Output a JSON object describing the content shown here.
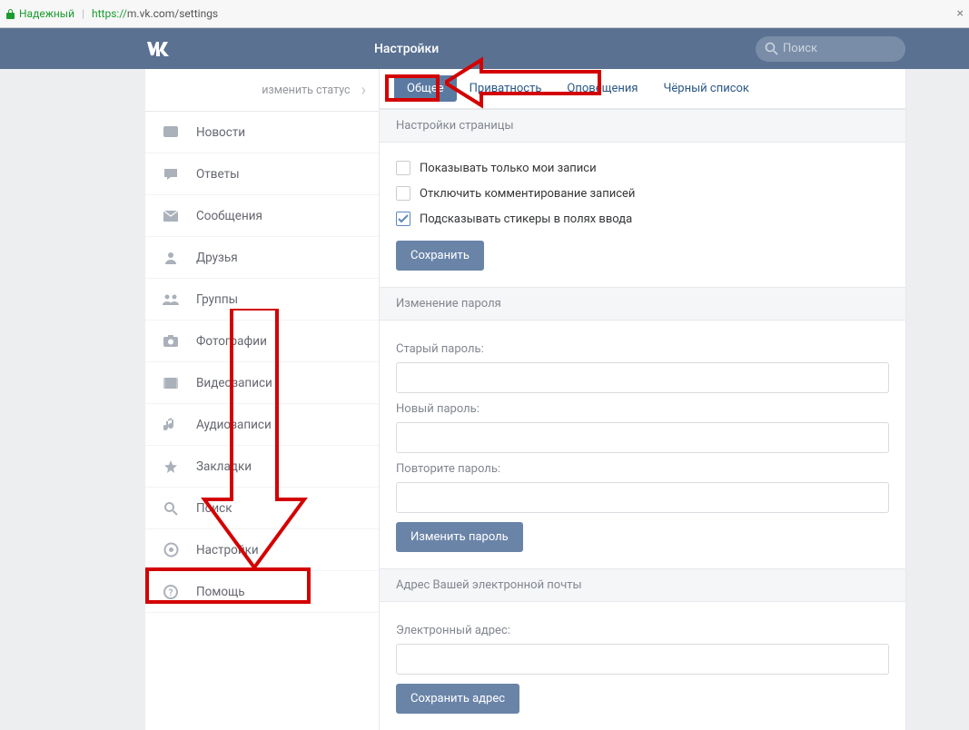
{
  "browser": {
    "secure_label": "Надежный",
    "url_proto": "https://",
    "url_rest": "m.vk.com/settings"
  },
  "header": {
    "title": "Настройки",
    "search_placeholder": "Поиск"
  },
  "sidebar": {
    "status": "изменить статус",
    "items": [
      {
        "label": "Новости"
      },
      {
        "label": "Ответы"
      },
      {
        "label": "Сообщения"
      },
      {
        "label": "Друзья"
      },
      {
        "label": "Группы"
      },
      {
        "label": "Фотографии"
      },
      {
        "label": "Видеозаписи"
      },
      {
        "label": "Аудиозаписи"
      },
      {
        "label": "Закладки"
      },
      {
        "label": "Поиск"
      },
      {
        "label": "Настройки"
      },
      {
        "label": "Помощь"
      }
    ]
  },
  "tabs": {
    "general": "Общее",
    "privacy": "Приватность",
    "notifications": "Оповещения",
    "blacklist": "Чёрный список"
  },
  "sections": {
    "page": {
      "title": "Настройки страницы",
      "chk1": "Показывать только мои записи",
      "chk2": "Отключить комментирование записей",
      "chk3": "Подсказывать стикеры в полях ввода",
      "save": "Сохранить"
    },
    "password": {
      "title": "Изменение пароля",
      "old": "Старый пароль:",
      "new": "Новый пароль:",
      "repeat": "Повторите пароль:",
      "btn": "Изменить пароль"
    },
    "email": {
      "title": "Адрес Вашей электронной почты",
      "label": "Электронный адрес:",
      "btn": "Сохранить адрес"
    }
  }
}
